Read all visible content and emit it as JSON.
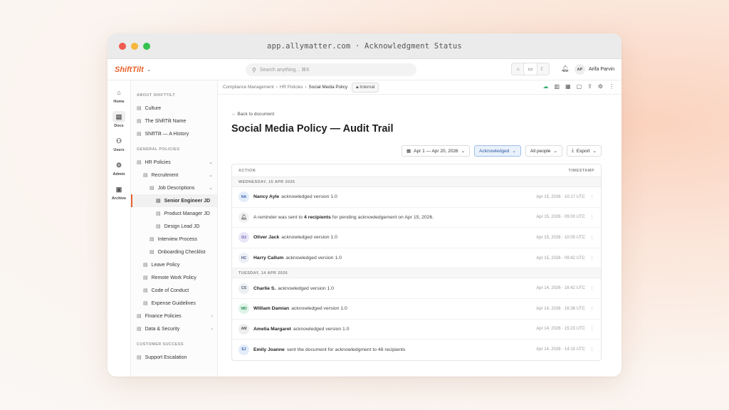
{
  "browser": {
    "url_title": "app.allymatter.com · Acknowledgment Status",
    "dot_colors": [
      "#f05a4f",
      "#f6b73c",
      "#36c24f"
    ]
  },
  "app": {
    "brand": "ShiftTilt",
    "search_placeholder": "Search anything... ⌘K",
    "user_initials": "AP",
    "user_name": "Arifa Parvin"
  },
  "rail": [
    {
      "label": "Home",
      "icon": "home-icon",
      "glyph": "⌂"
    },
    {
      "label": "Docs",
      "icon": "docs-icon",
      "glyph": "▤"
    },
    {
      "label": "Users",
      "icon": "users-icon",
      "glyph": "⚇"
    },
    {
      "label": "Admin",
      "icon": "admin-icon",
      "glyph": "⚙"
    },
    {
      "label": "Archive",
      "icon": "archive-icon",
      "glyph": "▣"
    }
  ],
  "sidebar": {
    "sections": [
      {
        "title": "ABOUT SHIFTTILT",
        "items": [
          {
            "label": "Culture",
            "indent": 0
          },
          {
            "label": "The ShiftTilt Name",
            "indent": 0
          },
          {
            "label": "ShiftTilt — A History",
            "indent": 0
          }
        ]
      },
      {
        "title": "GENERAL POLICIES",
        "items": [
          {
            "label": "HR Policies",
            "indent": 0,
            "chev": "⌄"
          },
          {
            "label": "Recruitment",
            "indent": 1,
            "chev": "⌄"
          },
          {
            "label": "Job Descriptions",
            "indent": 2,
            "chev": "⌄"
          },
          {
            "label": "Senior Engineer JD",
            "indent": 3,
            "active": true
          },
          {
            "label": "Product Manager JD",
            "indent": 3
          },
          {
            "label": "Design Lead JD",
            "indent": 3
          },
          {
            "label": "Interview Process",
            "indent": 2
          },
          {
            "label": "Onboarding Checklist",
            "indent": 2
          },
          {
            "label": "Leave Policy",
            "indent": 1
          },
          {
            "label": "Remote Work Policy",
            "indent": 1
          },
          {
            "label": "Code of Conduct",
            "indent": 1
          },
          {
            "label": "Expense Guidelines",
            "indent": 1
          },
          {
            "label": "Finance Policies",
            "indent": 0,
            "chev": "›"
          },
          {
            "label": "Data & Security",
            "indent": 0,
            "chev": "›"
          }
        ]
      },
      {
        "title": "CUSTOMER SUCCESS",
        "items": [
          {
            "label": "Support Escalation",
            "indent": 0
          }
        ]
      }
    ]
  },
  "breadcrumb": {
    "items": [
      "Compliance Management",
      "HR Policies"
    ],
    "current": "Social Media Policy",
    "badge": "Internal"
  },
  "page": {
    "back_label": "Back to document",
    "title": "Social Media Policy — Audit Trail",
    "filters": {
      "date_range": "Apr 1 — Apr 20, 2026",
      "status": "Acknowledged",
      "people": "All people",
      "export": "Export"
    }
  },
  "table": {
    "col_action": "ACTION",
    "col_timestamp": "TIMESTAMP",
    "groups": [
      {
        "label": "WEDNESDAY, 15 APR 2026",
        "rows": [
          {
            "initials": "NA",
            "name": "Nancy Ayle",
            "text": "acknowledged version 1.0",
            "ts": "Apr 15, 2026 · 10:17 UTC",
            "bg": "#e3ecfa",
            "fg": "#3b63a8"
          },
          {
            "system": true,
            "pre": "A reminder was sent to ",
            "bold": "4 recipients",
            "post": " for pending acknowledgement on Apr 15, 2026.",
            "ts": "Apr 15, 2026 · 09:00 UTC"
          },
          {
            "initials": "OJ",
            "name": "Oliver Jack",
            "text": "acknowledged version 1.0",
            "ts": "Apr 15, 2026 · 10:05 UTC",
            "bg": "#e9e7f8",
            "fg": "#5b50a8"
          },
          {
            "initials": "HC",
            "name": "Harry Callum",
            "text": "acknowledged version 1.0",
            "ts": "Apr 15, 2026 · 09:42 UTC",
            "bg": "#eef0f7",
            "fg": "#4b5a86"
          }
        ]
      },
      {
        "label": "TUESDAY, 14 APR 2026",
        "rows": [
          {
            "initials": "CS",
            "name": "Charlie S.",
            "text": "acknowledged version 1.0",
            "ts": "Apr 14, 2026 · 16:42 UTC",
            "bg": "#eceff3",
            "fg": "#4d5966"
          },
          {
            "initials": "WD",
            "name": "William Damian",
            "text": "acknowledged version 1.0",
            "ts": "Apr 14, 2026 · 16:38 UTC",
            "bg": "#dff4e8",
            "fg": "#2f8a57"
          },
          {
            "initials": "AM",
            "name": "Amelia Margaret",
            "text": "acknowledged version 1.0",
            "ts": "Apr 14, 2026 · 15:23 UTC",
            "bg": "#eeeeee",
            "fg": "#555555"
          },
          {
            "initials": "EJ",
            "name": "Emily Joanne",
            "text": "sent the document for acknowledgment to 48 recipients",
            "ts": "Apr 14, 2026 · 14:15 UTC",
            "bg": "#e3ecfa",
            "fg": "#3b63a8"
          }
        ]
      }
    ]
  },
  "colors": {
    "accent": "#e8622d",
    "selected_filter": "#e9f1fc"
  }
}
